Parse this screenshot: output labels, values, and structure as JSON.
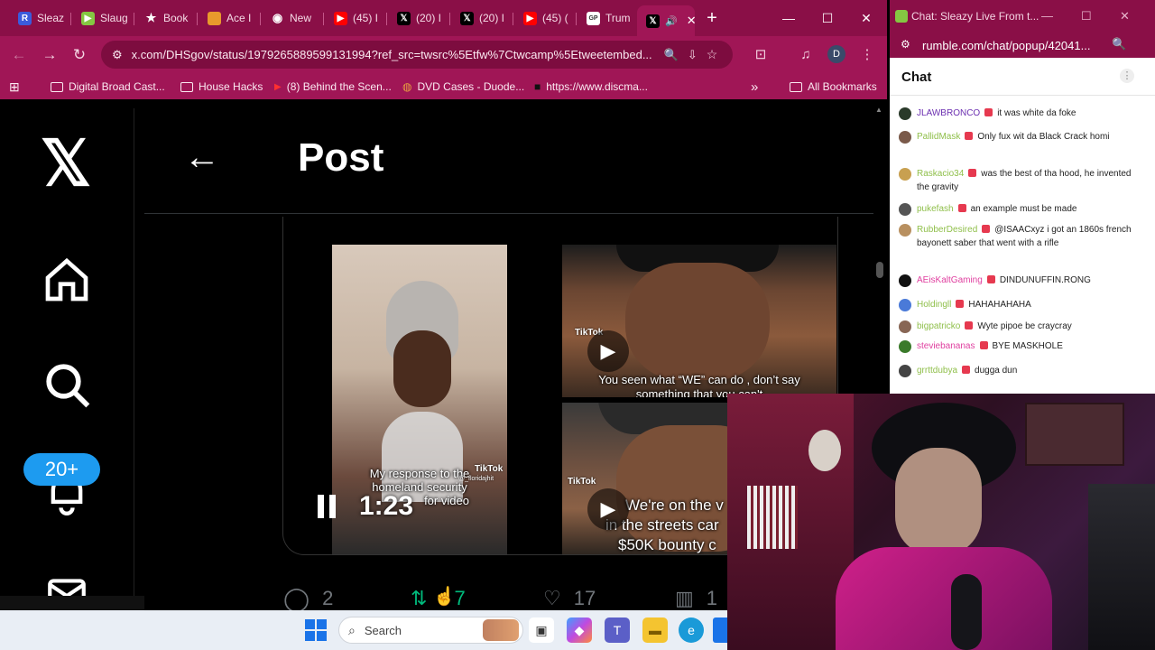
{
  "browser": {
    "tabs": [
      {
        "label": "Sleaz",
        "icon": "rumble-r-icon",
        "color": "#3b5bdb"
      },
      {
        "label": "Slaug",
        "icon": "rumble-play-icon",
        "color": "#85c742"
      },
      {
        "label": "Book",
        "icon": "star-icon",
        "color": "#ffffff"
      },
      {
        "label": "Ace I",
        "icon": "nbc-icon",
        "color": "#e89a2c"
      },
      {
        "label": "New",
        "icon": "chrome-icon",
        "color": "#ffffff"
      },
      {
        "label": "(45) I",
        "icon": "youtube-icon",
        "color": "#ff0000"
      },
      {
        "label": "(20) I",
        "icon": "x-icon",
        "color": "#000000"
      },
      {
        "label": "(20) I",
        "icon": "x-icon",
        "color": "#000000"
      },
      {
        "label": "(45) (",
        "icon": "youtube-icon",
        "color": "#ff0000"
      },
      {
        "label": "Trum",
        "icon": "gp-icon",
        "color": "#ffffff"
      }
    ],
    "active_tab_icon": "x-icon",
    "new_tab": "+",
    "url": "x.com/DHSgov/status/1979265889599131994?ref_src=twsrc%5Etfw%7Ctwcamp%5Etweetembed...",
    "profile_initial": "D",
    "bookmarks": [
      {
        "label": "Digital Broad Cast...",
        "icon": "folder-icon"
      },
      {
        "label": "House Hacks",
        "icon": "folder-icon"
      },
      {
        "label": "(8) Behind the Scen...",
        "icon": "youtube-icon"
      },
      {
        "label": "DVD Cases - Duode...",
        "icon": "dvd-icon"
      },
      {
        "label": "https://www.discma...",
        "icon": "discma-icon"
      }
    ],
    "more_bookmarks": "»",
    "all_bookmarks": "All Bookmarks"
  },
  "x": {
    "page_title": "Post",
    "notification_count": "20+",
    "video": {
      "timer": "1:23",
      "caption_main_1": "My response to the",
      "caption_main_2": "homeland security",
      "caption_main_3": "for video",
      "caption_tr_1": "You seen what “WE” can do , don’t say",
      "caption_tr_2": "something that you can't",
      "caption_br_1": "We're on the v",
      "caption_br_2": "in the streets car",
      "caption_br_3": "$50K bounty c",
      "tiktok_label": "TikTok",
      "tiktok_handle": "@_floridajhit"
    },
    "actions": {
      "replies": "2",
      "reposts": "7",
      "likes": "17",
      "views": "1"
    }
  },
  "chat": {
    "window_title": "Chat: Sleazy Live From t...",
    "url": "rumble.com/chat/popup/42041...",
    "header": "Chat",
    "messages": [
      {
        "user": "JLAWBRONCO",
        "color": "#6b2fb0",
        "text": "it was white da foke",
        "avatar": "#2a3a2a"
      },
      {
        "user": "PallidMask",
        "color": "#8fbf4a",
        "text": "Only fux wit da Black Crack homi",
        "avatar": "#7a5a4a"
      },
      {
        "user": "Raskacio34",
        "color": "#8fbf4a",
        "text": "was the best of tha hood, he invented the gravity",
        "avatar": "#c8a050"
      },
      {
        "user": "pukefash",
        "color": "#8fbf4a",
        "text": "an example must be made",
        "avatar": "#555555"
      },
      {
        "user": "RubberDesired",
        "color": "#8fbf4a",
        "text": "@ISAACxyz i got an 1860s french bayonett saber that went with a rifle",
        "avatar": "#b89060",
        "mention": "@ISAACxyz"
      },
      {
        "user": "AEisKaltGaming",
        "color": "#e040a0",
        "text": "DINDUNUFFIN.RONG",
        "avatar": "#111111"
      },
      {
        "user": "Holdingll",
        "color": "#8fbf4a",
        "text": "HAHAHAHAHA",
        "avatar": "#4a7ad8"
      },
      {
        "user": "bigpatricko",
        "color": "#8fbf4a",
        "text": "Wyte pipoe be craycray",
        "avatar": "#886655"
      },
      {
        "user": "steviebananas",
        "color": "#e040a0",
        "text": "BYE MASKHOLE",
        "avatar": "#3a7a2a"
      },
      {
        "user": "grrttdubya",
        "color": "#8fbf4a",
        "text": "dugga dun",
        "avatar": "#444444"
      }
    ]
  },
  "taskbar": {
    "search_placeholder": "Search"
  }
}
